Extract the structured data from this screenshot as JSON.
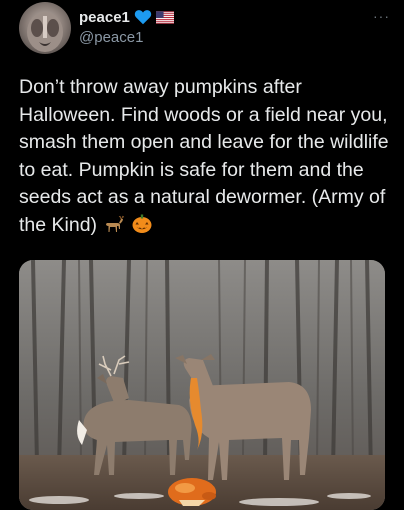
{
  "author": {
    "display_name": "peace1",
    "handle": "@peace1",
    "badge_icons": [
      "blue-heart-icon",
      "us-flag-icon"
    ]
  },
  "more_label": "···",
  "tweet": {
    "text": "Don’t throw away pumpkins after Halloween. Find woods or a field near you, smash them open and leave for the wildlife to eat. Pumpkin is safe for them and the seeds act as a natural dewormer.  (Army of the Kind)",
    "trailing_icons": [
      "deer-icon",
      "jack-o-lantern-icon"
    ]
  },
  "media": {
    "subject": "photo-deer-eating-pumpkin"
  },
  "colors": {
    "background": "#000000",
    "text": "#e7e9ea",
    "secondary_text": "#8b98a5",
    "heart": "#1d9bf0"
  }
}
